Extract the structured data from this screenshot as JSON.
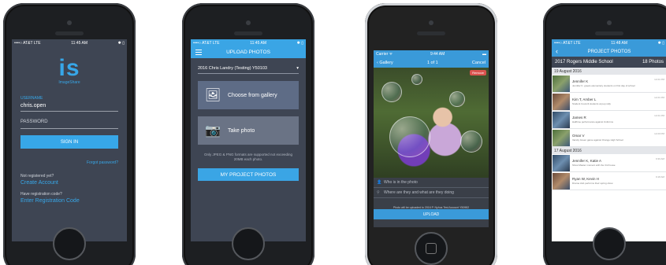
{
  "phone1": {
    "status": {
      "carrier": "••••○ AT&T  LTE",
      "time": "11:45 AM",
      "battery": "✱ ▯"
    },
    "logo_text": "is",
    "logo_sub": "ImageShare",
    "username_label": "USERNAME",
    "username_value": "chris.open",
    "password_placeholder": "PASSWORD",
    "signin_label": "SIGN IN",
    "forgot_label": "Forgot password?",
    "not_registered": "Not registered yet?",
    "create_account": "Create Account",
    "have_code": "Have registration code?",
    "enter_code": "Enter Registration Code"
  },
  "phone2": {
    "status": {
      "carrier": "••••○ AT&T  LTE",
      "time": "11:45 AM",
      "battery": "✱ ▯"
    },
    "title": "UPLOAD PHOTOS",
    "project_select": "2016 Chris Landry (Testing) Y50103",
    "choose_gallery": "Choose from gallery",
    "take_photo": "Take photo",
    "note": "Only JPEG & PNG formats are supported not exceeding 20MB each photo.",
    "my_project_photos": "MY PROJECT PHOTOS",
    "version": "Version 2.0"
  },
  "phone3": {
    "status": {
      "carrier": "Carrier ᯤ",
      "time": "9:44 AM",
      "battery": "▬"
    },
    "back_label": "‹ Gallery",
    "counter": "1 of 1",
    "cancel_label": "Cancel",
    "remove_label": "Remove",
    "who_placeholder": "Who is in the photo",
    "where_placeholder": "Where are they and what are they doing",
    "fine_print": "Photo will be uploaded to 2016 P. Nyhus Test Account Y50982",
    "upload_label": "UPLOAD"
  },
  "phone4": {
    "status": {
      "carrier": "••••○ AT&T  LTE",
      "time": "11:48 AM",
      "battery": "✱ ▯"
    },
    "title": "PROJECT PHOTOS",
    "school": "2017 Rogers Middle School",
    "photo_count": "18 Photos",
    "groups": [
      {
        "date": "19 August 2016",
        "items": [
          {
            "name": "Jennifer K",
            "desc": "Jennifer K. greets elementary students on first day of school",
            "time": "12:21 PM"
          },
          {
            "name": "Kim T, Amber L",
            "desc": "Student Council students at pep rally",
            "time": "12:21 PM"
          },
          {
            "name": "James R",
            "desc": "Halftime performance against Uniforms",
            "time": "12:21 PM"
          },
          {
            "name": "Omar V",
            "desc": "Varsity Green game against Orange High School",
            "time": "12:20 PM"
          }
        ]
      },
      {
        "date": "17 August 2016",
        "items": [
          {
            "name": "Jennifer K, Katie A",
            "desc": "Show Master moment with the 3rd house",
            "time": "9:30 AM"
          },
          {
            "name": "Ryan W, Kevin H",
            "desc": "Drama club performs their spring show",
            "time": "9:18 AM"
          }
        ]
      }
    ]
  }
}
